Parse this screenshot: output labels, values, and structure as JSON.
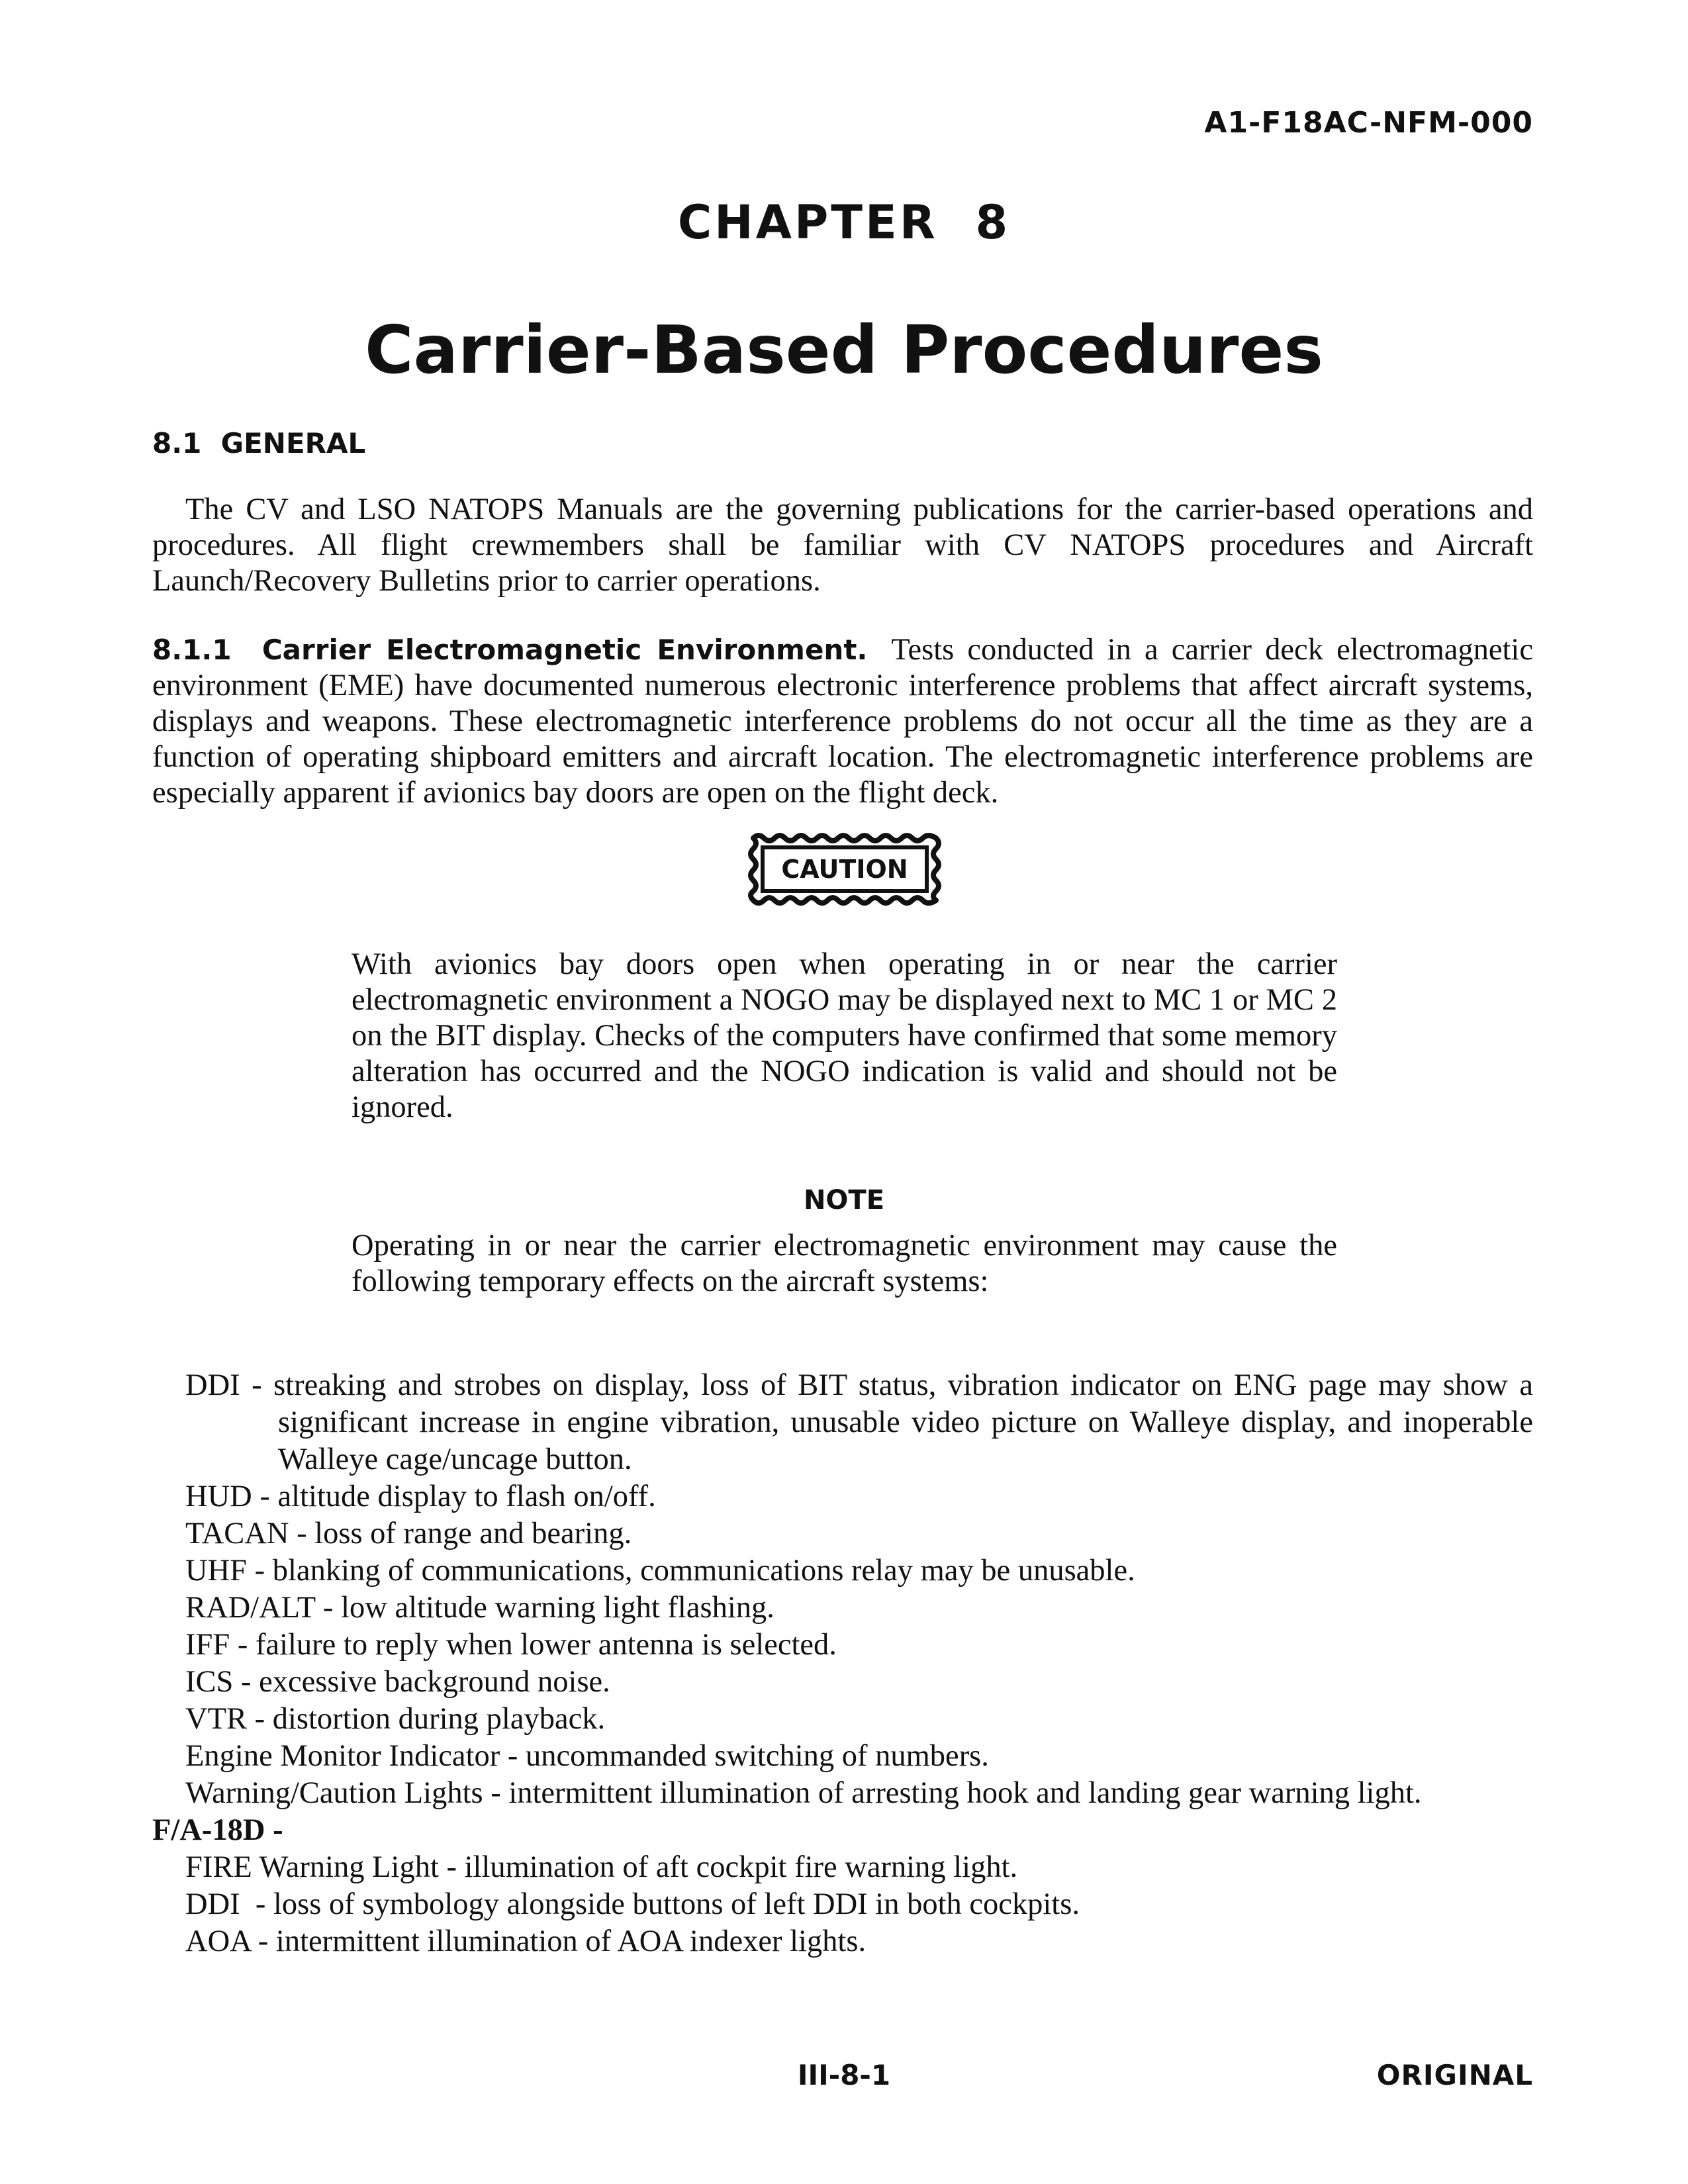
{
  "header": {
    "doc_id": "A1-F18AC-NFM-000"
  },
  "chapter": {
    "label": "CHAPTER  8",
    "title": "Carrier-Based Procedures"
  },
  "section": {
    "heading": "8.1  GENERAL",
    "para": "The CV and LSO NATOPS Manuals are the governing publications for the carrier-based operations and procedures. All flight crewmembers shall be familiar with CV NATOPS procedures and Aircraft Launch/Recovery Bulletins prior to carrier operations."
  },
  "subsection": {
    "heading": "8.1.1  Carrier Electromagnetic Environment.",
    "para": "Tests conducted in a carrier deck electromagnetic environment (EME) have documented numerous electronic interference problems that affect aircraft systems, displays and weapons. These electromagnetic interference problems do not occur all the time as they are a function of operating shipboard emitters and aircraft location. The electromagnetic interference problems are especially apparent if avionics bay doors are open on the flight deck."
  },
  "caution": {
    "label": "CAUTION",
    "text": "With avionics bay doors open when operating in or near the carrier electromagnetic environment a NOGO may be displayed next to MC 1 or MC 2 on the BIT display. Checks of the computers have confirmed that some memory alteration has occurred and the NOGO indication is valid and should not be ignored."
  },
  "note": {
    "label": "NOTE",
    "text": "Operating in or near the carrier electromagnetic environment may cause the following temporary effects on the aircraft systems:"
  },
  "effects": [
    "DDI - streaking and strobes on display, loss of BIT status, vibration indicator on ENG page may show a significant increase in engine vibration, unusable video picture on Walleye display, and inoperable Walleye cage/uncage button.",
    "HUD - altitude display to flash on/off.",
    "TACAN - loss of range and bearing.",
    "UHF - blanking of communications, communications relay may be unusable.",
    "RAD/ALT - low altitude warning light flashing.",
    "IFF - failure to reply when lower antenna is selected.",
    "ICS - excessive background noise.",
    "VTR - distortion during playback.",
    "Engine Monitor Indicator - uncommanded switching of numbers.",
    "Warning/Caution Lights - intermittent illumination of arresting hook and landing gear warning light."
  ],
  "fa18d": {
    "heading": "F/A-18D -",
    "effects": [
      "FIRE Warning Light - illumination of aft cockpit fire warning light.",
      "DDI  - loss of symbology alongside buttons of left DDI in both cockpits.",
      "AOA - intermittent illumination of AOA indexer lights."
    ]
  },
  "footer": {
    "page_number": "III-8-1",
    "status": "ORIGINAL"
  }
}
